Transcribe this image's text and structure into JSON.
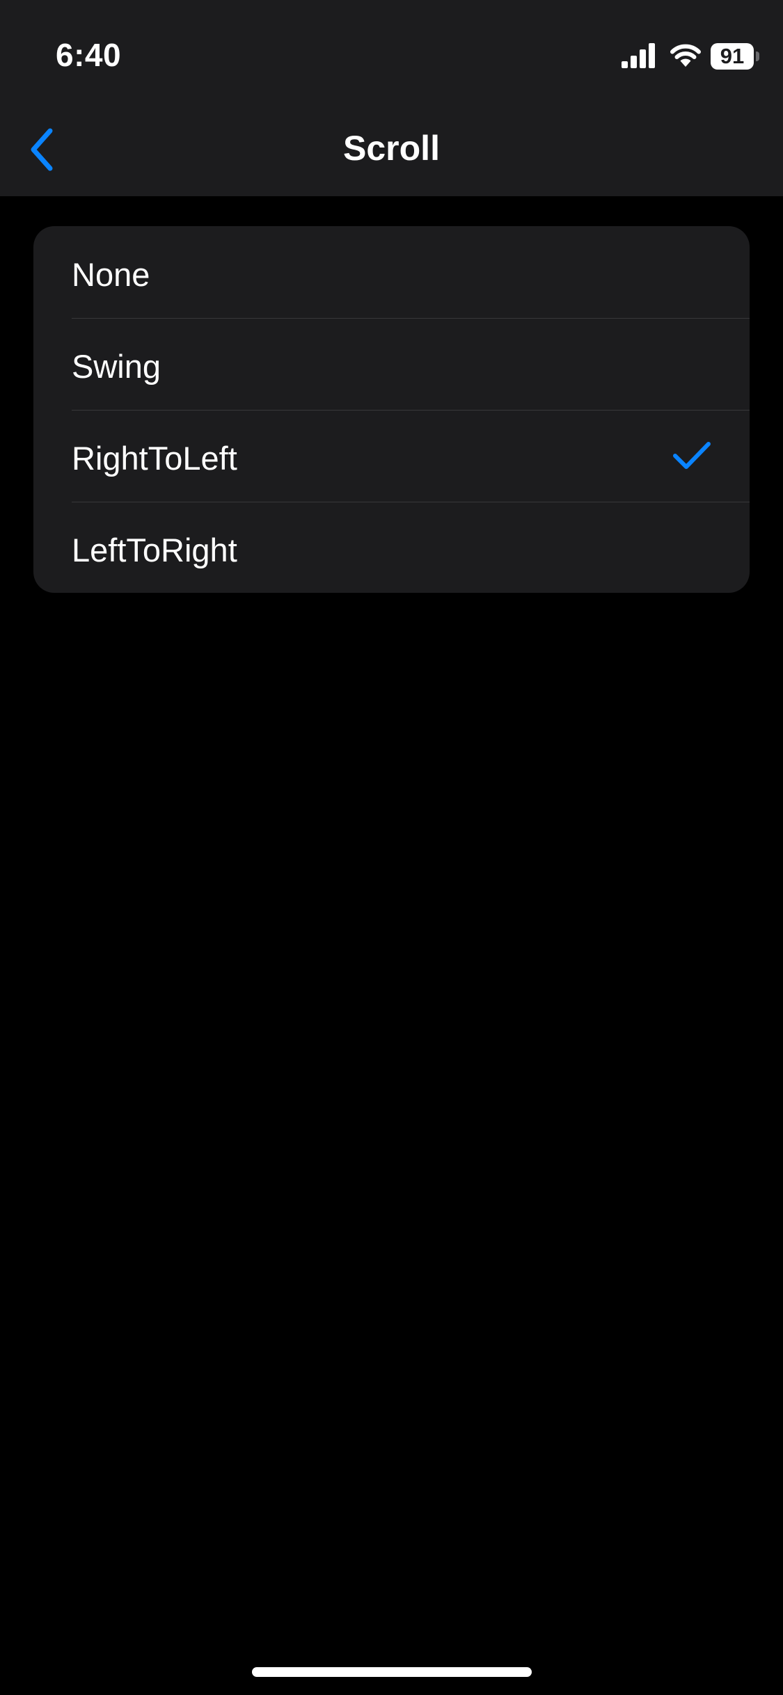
{
  "status_bar": {
    "time": "6:40",
    "battery_level": "91",
    "icons": [
      "cellular-signal-icon",
      "wifi-icon",
      "battery-icon"
    ]
  },
  "nav": {
    "title": "Scroll",
    "back_icon": "chevron-left-icon"
  },
  "options": {
    "items": [
      {
        "label": "None",
        "selected": false
      },
      {
        "label": "Swing",
        "selected": false
      },
      {
        "label": "RightToLeft",
        "selected": true
      },
      {
        "label": "LeftToRight",
        "selected": false
      }
    ],
    "selected_value": "RightToLeft",
    "check_icon": "checkmark-icon"
  },
  "colors": {
    "accent": "#0a84ff",
    "background": "#000000",
    "surface": "#1c1c1e",
    "separator": "#38383a",
    "text": "#ffffff"
  }
}
